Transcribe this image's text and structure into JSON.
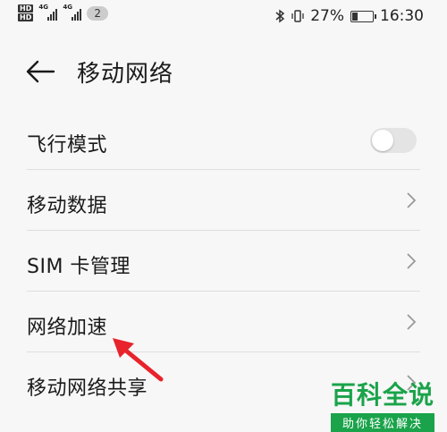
{
  "status_bar": {
    "hd_top": "HD",
    "hd_bottom": "HD",
    "net1": "4G",
    "net2": "4G",
    "sim_badge": "2",
    "battery_text": "27%",
    "battery_level": 0.27,
    "time": "16:30"
  },
  "header": {
    "title": "移动网络"
  },
  "menu": {
    "items": [
      {
        "label": "飞行模式",
        "control": "toggle",
        "toggle_on": false
      },
      {
        "label": "移动数据",
        "control": "chevron"
      },
      {
        "label": "SIM 卡管理",
        "control": "chevron"
      },
      {
        "label": "网络加速",
        "control": "chevron"
      },
      {
        "label": "移动网络共享",
        "control": "chevron"
      }
    ]
  },
  "watermark": {
    "brand": "百科全说",
    "slogan": "助你轻松解决"
  },
  "colors": {
    "arrow": "#e8232b",
    "watermark_green": "#1aa34a",
    "toggle_off": "#e4e4e4"
  }
}
